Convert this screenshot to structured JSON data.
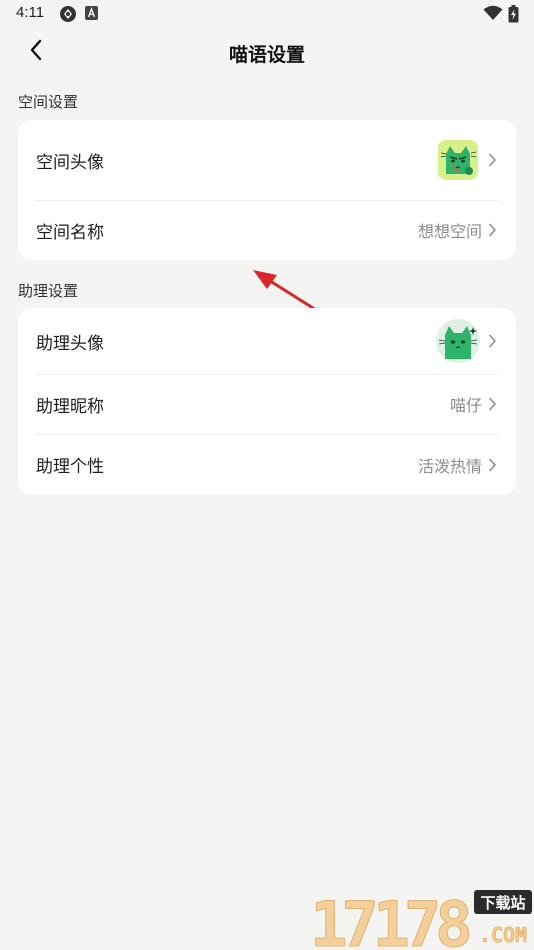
{
  "status_bar": {
    "time": "4:11"
  },
  "header": {
    "title": "喵语设置"
  },
  "space_section": {
    "title": "空间设置",
    "avatar_label": "空间头像",
    "name_label": "空间名称",
    "name_value": "想想空间"
  },
  "assistant_section": {
    "title": "助理设置",
    "avatar_label": "助理头像",
    "nickname_label": "助理昵称",
    "nickname_value": "喵仔",
    "personality_label": "助理个性",
    "personality_value": "活泼热情"
  },
  "watermark": {
    "number": "17178",
    "tag": "下载站",
    "suffix": ".COM"
  },
  "colors": {
    "background": "#f4f5f2",
    "card": "#ffffff",
    "annotation_arrow": "#d9262b",
    "cat_green": "#2fb36b"
  }
}
